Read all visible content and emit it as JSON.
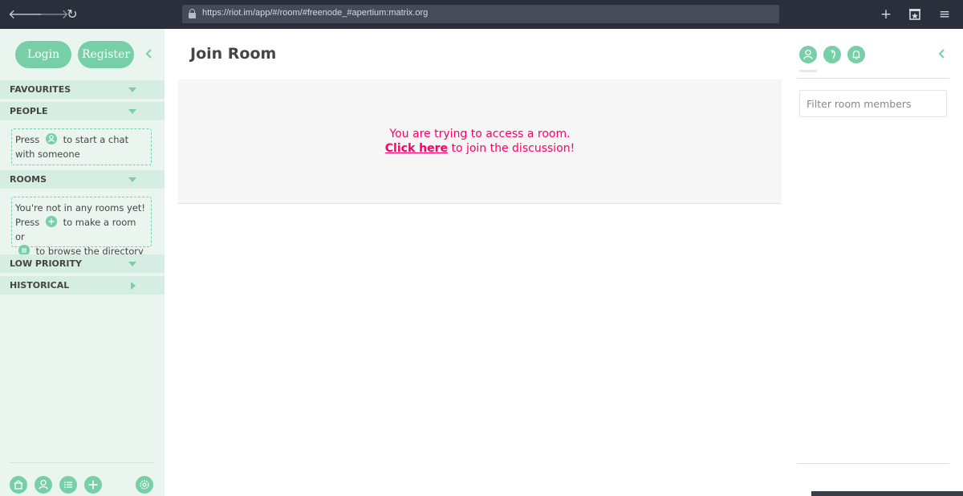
{
  "browser": {
    "url": "https://riot.im/app/#/room/#freenode_#apertium:matrix.org",
    "back_glyph": "🡐",
    "forward_glyph": "🡒",
    "reload_glyph": "↻",
    "new_tab_glyph": "+",
    "menu_glyph": "≡"
  },
  "sidebar": {
    "login_label": "Login",
    "register_label": "Register",
    "sections": {
      "favourites": "FAVOURITES",
      "people": "PEOPLE",
      "rooms": "ROOMS",
      "low_priority": "LOW PRIORITY",
      "historical": "HISTORICAL"
    },
    "people_hint": {
      "before": "Press",
      "after": "to start a chat with someone"
    },
    "rooms_hint": {
      "line1": "You're not in any rooms yet!",
      "press": "Press",
      "make_room": "to make a room or",
      "browse": "to browse the directory"
    }
  },
  "main": {
    "title": "Join Room",
    "message_line1": "You are trying to access a room.",
    "click_here": "Click here",
    "message_line2_rest": " to join the discussion!"
  },
  "right_panel": {
    "filter_placeholder": "Filter room members"
  },
  "colors": {
    "accent": "#76cfa6",
    "warning_text": "#ff0064",
    "sidebar_bg": "#eaf5f0",
    "section_bg": "#d6ede3"
  }
}
